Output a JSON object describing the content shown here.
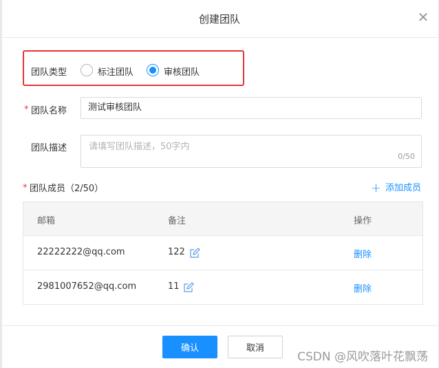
{
  "dialog": {
    "title": "创建团队",
    "close_glyph": "✕"
  },
  "team_type": {
    "label": "团队类型",
    "options": [
      "标注团队",
      "审核团队"
    ],
    "selected": "审核团队"
  },
  "team_name": {
    "label": "团队名称",
    "value": "测试审核团队"
  },
  "team_desc": {
    "label": "团队描述",
    "placeholder": "请填写团队描述，50字内",
    "counter": "0/50"
  },
  "members": {
    "label": "团队成员（2/50）",
    "add_label": "添加成员",
    "columns": [
      "邮箱",
      "备注",
      "操作"
    ],
    "rows": [
      {
        "email": "22222222@qq.com",
        "note": "122",
        "action": "删除"
      },
      {
        "email": "2981007652@qq.com",
        "note": "11",
        "action": "删除"
      }
    ]
  },
  "footer": {
    "confirm_label": "确认",
    "cancel_label": "取消"
  },
  "watermark": "CSDN @风吹落叶花飘荡",
  "colors": {
    "accent": "#1890ff",
    "required": "#e03c3c",
    "highlight": "#e63232"
  },
  "icons": {
    "close": "close-icon",
    "add": "plus-icon",
    "edit": "edit-icon"
  }
}
